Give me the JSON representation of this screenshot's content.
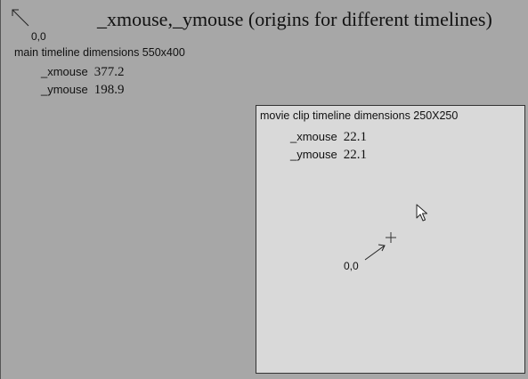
{
  "header": {
    "title": "_xmouse,_ymouse (origins for different timelines)"
  },
  "main_timeline": {
    "origin_label": "0,0",
    "dimensions_label": "main timeline dimensions 550x400",
    "xmouse_label": "_xmouse",
    "xmouse_value": "377.2",
    "ymouse_label": "_ymouse",
    "ymouse_value": "198.9"
  },
  "movie_clip": {
    "dimensions_label": "movie clip timeline dimensions 250X250",
    "xmouse_label": "_xmouse",
    "xmouse_value": "22.1",
    "ymouse_label": "_ymouse",
    "ymouse_value": "22.1",
    "origin_label": "0,0"
  },
  "icons": {
    "main_origin_arrow": "arrow-up-left-icon",
    "clip_origin_arrow": "arrow-up-right-icon",
    "clip_registration": "crosshair-icon",
    "cursor": "mouse-pointer-icon"
  }
}
